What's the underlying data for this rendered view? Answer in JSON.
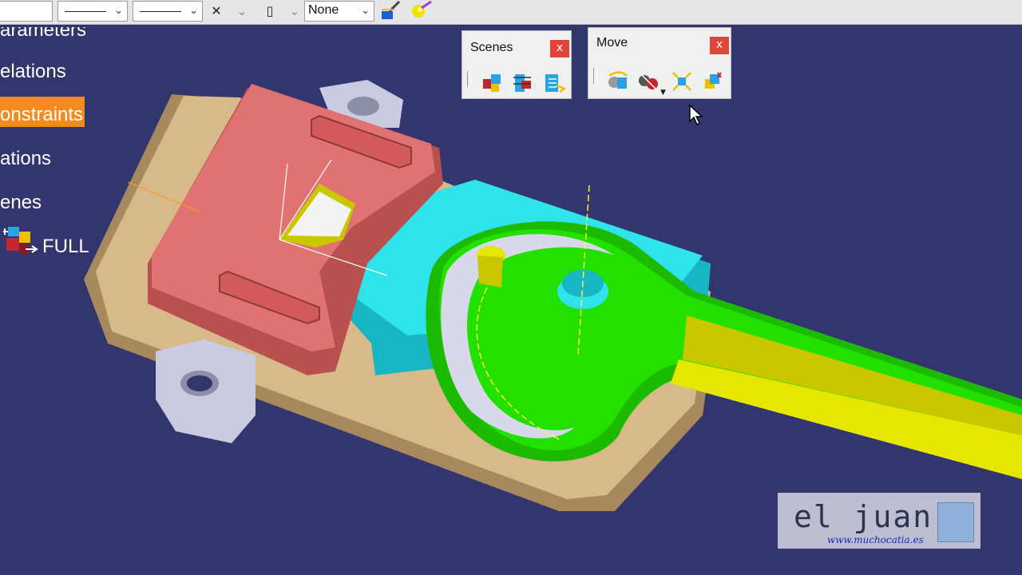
{
  "toolbar": {
    "layer_value": "None"
  },
  "tree": {
    "items": [
      {
        "label": "arameters"
      },
      {
        "label": "elations"
      },
      {
        "label": "onstraints"
      },
      {
        "label": "ations"
      },
      {
        "label": "enes"
      },
      {
        "label": "FULL"
      }
    ]
  },
  "panels": {
    "scenes": {
      "title": "Scenes",
      "close": "x"
    },
    "move": {
      "title": "Move",
      "close": "x"
    }
  },
  "watermark": {
    "title": "el juanri",
    "url": "www.muchocatia.es"
  },
  "colors": {
    "background": "#33356f",
    "selection": "#f58b1f",
    "base_plate": "#d8b98a",
    "clamp": "#e07070",
    "slide": "#28d8e0",
    "cam": "#22e000",
    "handle": "#e6e600"
  }
}
